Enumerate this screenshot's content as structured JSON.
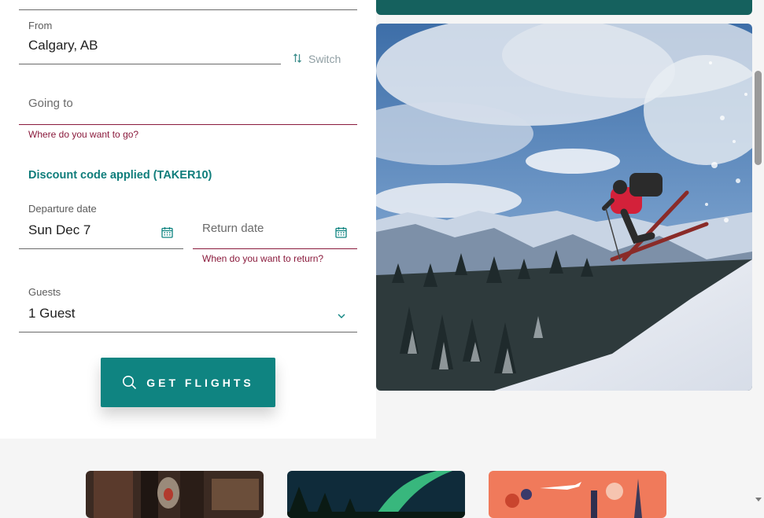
{
  "form": {
    "from": {
      "label": "From",
      "value": "Calgary, AB"
    },
    "switch_label": "Switch",
    "going_to": {
      "placeholder": "Going to",
      "error": "Where do you want to go?"
    },
    "discount": "Discount code applied (TAKER10)",
    "departure": {
      "label": "Departure date",
      "value": "Sun Dec 7"
    },
    "return": {
      "placeholder": "Return date",
      "error": "When do you want to return?"
    },
    "guests": {
      "label": "Guests",
      "value": "1 Guest"
    },
    "submit_label": "GET FLIGHTS"
  },
  "colors": {
    "accent": "#0f8481",
    "error": "#8a1a3c",
    "link": "#0f7d7b",
    "dark_teal": "#15615e"
  },
  "icons": [
    "swap-icon",
    "calendar-icon",
    "chevron-down-icon",
    "search-icon"
  ]
}
